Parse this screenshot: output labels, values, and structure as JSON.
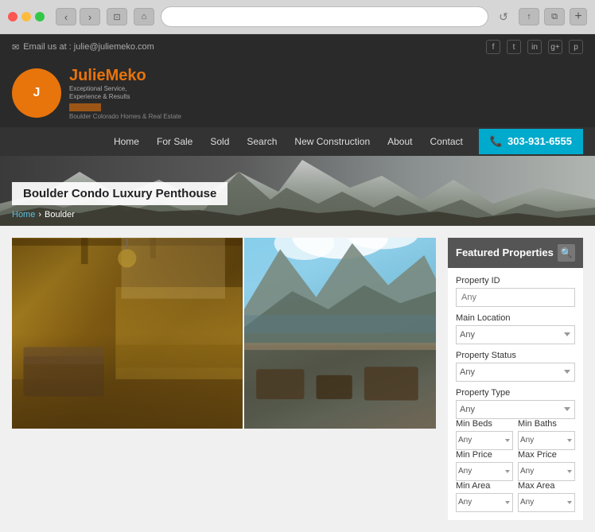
{
  "browser": {
    "address": "",
    "reload_icon": "↺",
    "back_icon": "‹",
    "forward_icon": "›",
    "tab_icon": "⊡",
    "home_icon": "⌂",
    "share_icon": "↑",
    "windows_icon": "⧉",
    "plus_icon": "+"
  },
  "topbar": {
    "email_label": "Email us at : julie@juliemeko.com",
    "email_icon": "✉"
  },
  "social": {
    "facebook": "f",
    "twitter": "t",
    "linkedin": "in",
    "google": "g+",
    "pinterest": "p"
  },
  "header": {
    "logo_first": "Julie",
    "logo_last": "Meko",
    "tagline_line1": "Exceptional Service,",
    "tagline_line2": "Experience & Results",
    "sub_label": "Boulder Colorado Homes & Real Estate"
  },
  "nav": {
    "items": [
      {
        "label": "Home",
        "id": "home"
      },
      {
        "label": "For Sale",
        "id": "for-sale"
      },
      {
        "label": "Sold",
        "id": "sold"
      },
      {
        "label": "Search",
        "id": "search"
      },
      {
        "label": "New Construction",
        "id": "new-construction"
      },
      {
        "label": "About",
        "id": "about"
      },
      {
        "label": "Contact",
        "id": "contact"
      }
    ],
    "phone": "303-931-6555",
    "phone_icon": "📞"
  },
  "hero": {
    "title": "Boulder Condo Luxury Penthouse",
    "breadcrumb_home": "Home",
    "breadcrumb_sep": "›",
    "breadcrumb_page": "Boulder"
  },
  "sidebar": {
    "featured_title": "Featured Properties",
    "search_tooltip": "Search",
    "filters": {
      "property_id_label": "Property ID",
      "property_id_placeholder": "Any",
      "main_location_label": "Main Location",
      "main_location_value": "Any",
      "property_status_label": "Property Status",
      "property_status_value": "Any",
      "property_type_label": "Property Type",
      "property_type_value": "Any",
      "min_beds_label": "Min Beds",
      "min_beds_value": "Any",
      "min_baths_label": "Min Baths",
      "min_baths_value": "Any",
      "min_price_label": "Min Price",
      "min_price_value": "Any",
      "max_price_label": "Max Price",
      "max_price_value": "Any",
      "min_area_label": "Min Area",
      "max_area_label": "Max Area"
    }
  }
}
